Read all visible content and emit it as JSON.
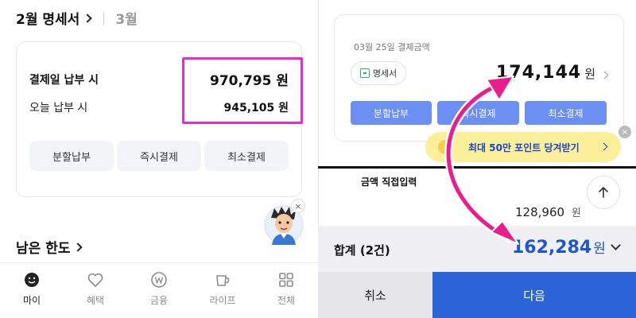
{
  "left": {
    "statement": {
      "title": "2월 명세서",
      "next_month": "3월"
    },
    "payment_card": {
      "row1_label": "결제일 납부 시",
      "row1_amount": "970,795 원",
      "row2_label": "오늘 납부 시",
      "row2_amount": "945,105 원",
      "buttons": [
        "분할납부",
        "즉시결제",
        "최소결제"
      ]
    },
    "mascot_close": "×",
    "limit_title": "남은 한도",
    "nav": [
      {
        "label": "마이",
        "icon": "smile-icon",
        "active": true
      },
      {
        "label": "혜택",
        "icon": "heart-icon",
        "active": false
      },
      {
        "label": "금융",
        "icon": "won-coin-icon",
        "active": false
      },
      {
        "label": "라이프",
        "icon": "cup-icon",
        "active": false
      },
      {
        "label": "전체",
        "icon": "grid-icon",
        "active": false
      }
    ]
  },
  "right": {
    "card": {
      "date_label": "03월 25일 결제금액",
      "pill_label": "명세서",
      "amount": "174,144",
      "amount_unit": "원",
      "buttons": [
        "분할납부",
        "즉시결제",
        "최소결제"
      ]
    },
    "promo": {
      "text": "최대 50만 포인트 당겨받기",
      "close": "×"
    },
    "direct_input_label": "금액 직접입력",
    "item_amount": "128,960",
    "item_unit": "원",
    "total": {
      "label": "합계 (2건)",
      "amount": "162,284",
      "unit": "원"
    },
    "cancel_label": "취소",
    "next_label": "다음"
  },
  "colors": {
    "highlight": "#e92bd6",
    "primary_blue": "#2b64d6",
    "light_blue_button": "#6b8ff2",
    "total_blue": "#1c56d6",
    "promo_yellow": "#fbef9a"
  }
}
